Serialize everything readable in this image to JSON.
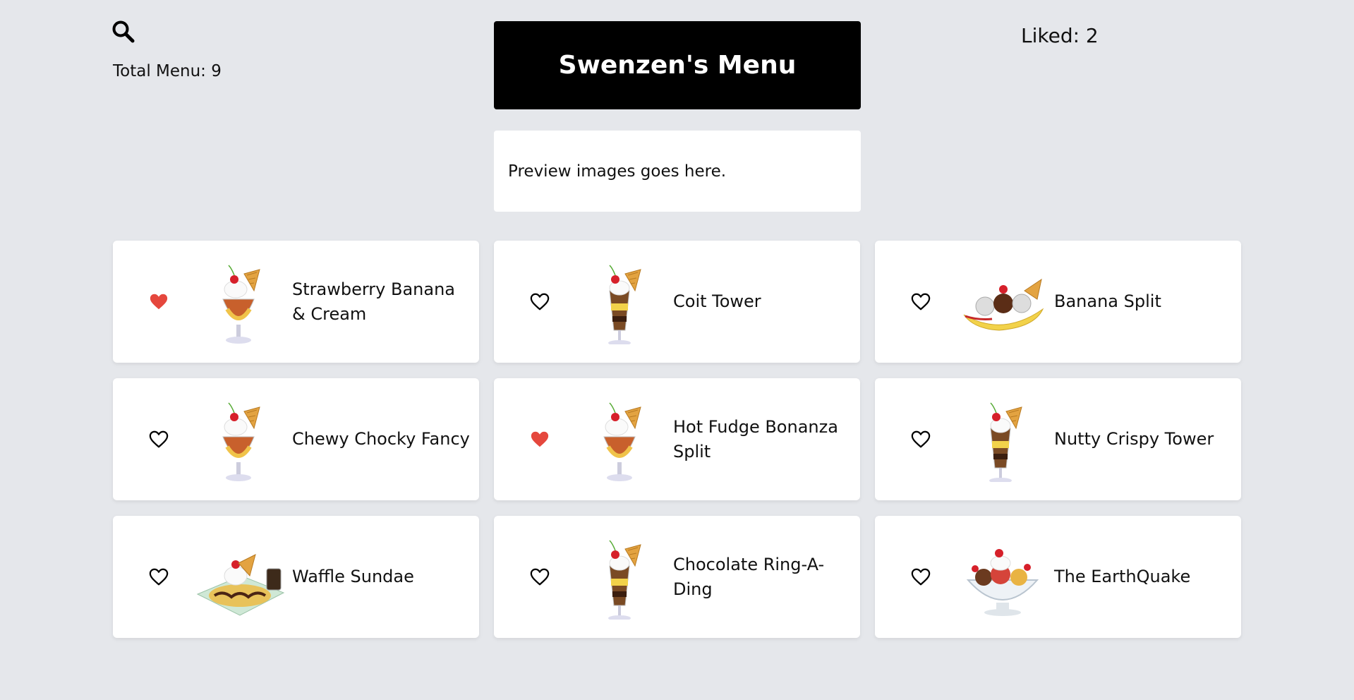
{
  "header": {
    "search_icon": "search-icon",
    "total_label": "Total Menu: 9",
    "title": "Swenzen's Menu",
    "liked_label": "Liked: 2",
    "preview_text": "Preview images goes here."
  },
  "colors": {
    "background": "#e5e7eb",
    "title_bg": "#000000",
    "liked_heart": "#e5473d",
    "card_bg": "#ffffff"
  },
  "menu": [
    {
      "name": "Strawberry Banana & Cream",
      "liked": true,
      "icon": "sundae-glass-icon"
    },
    {
      "name": "Coit Tower",
      "liked": false,
      "icon": "tall-parfait-icon"
    },
    {
      "name": "Banana Split",
      "liked": false,
      "icon": "banana-split-boat-icon"
    },
    {
      "name": "Chewy Chocky Fancy",
      "liked": false,
      "icon": "chocolate-sundae-icon"
    },
    {
      "name": "Hot Fudge Bonanza Split",
      "liked": true,
      "icon": "fudge-sundae-icon"
    },
    {
      "name": "Nutty Crispy Tower",
      "liked": false,
      "icon": "tall-parfait-icon"
    },
    {
      "name": "Waffle Sundae",
      "liked": false,
      "icon": "waffle-plate-icon"
    },
    {
      "name": "Chocolate Ring-A-Ding",
      "liked": false,
      "icon": "tall-parfait-icon"
    },
    {
      "name": "The EarthQuake",
      "liked": false,
      "icon": "sundae-bowl-icon"
    }
  ]
}
